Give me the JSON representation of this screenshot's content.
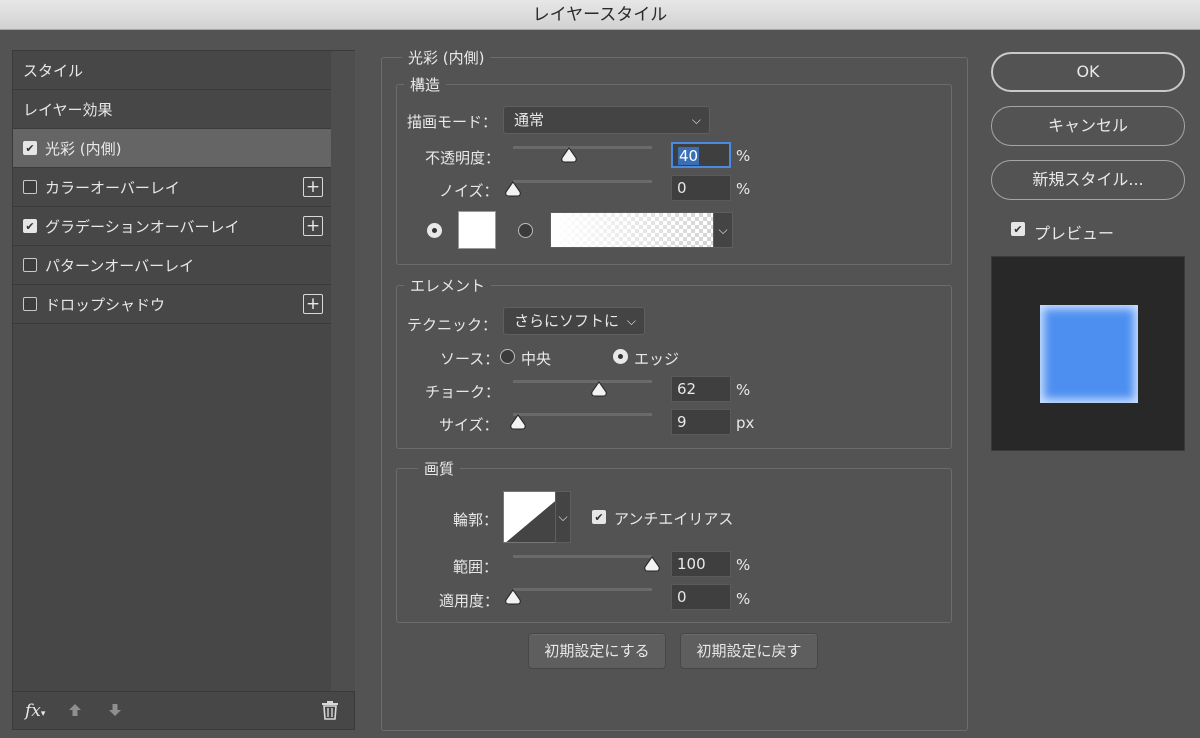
{
  "window": {
    "title": "レイヤースタイル"
  },
  "left_panel": {
    "items": [
      {
        "label": "スタイル",
        "checkbox": false,
        "checked": false,
        "plus": false,
        "selected": false
      },
      {
        "label": "レイヤー効果",
        "checkbox": false,
        "checked": false,
        "plus": false,
        "selected": false
      },
      {
        "label": "光彩 (内側)",
        "checkbox": true,
        "checked": true,
        "plus": false,
        "selected": true
      },
      {
        "label": "カラーオーバーレイ",
        "checkbox": true,
        "checked": false,
        "plus": true,
        "selected": false
      },
      {
        "label": "グラデーションオーバーレイ",
        "checkbox": true,
        "checked": true,
        "plus": true,
        "selected": false
      },
      {
        "label": "パターンオーバーレイ",
        "checkbox": true,
        "checked": false,
        "plus": false,
        "selected": false
      },
      {
        "label": "ドロップシャドウ",
        "checkbox": true,
        "checked": false,
        "plus": true,
        "selected": false
      }
    ],
    "footer": {
      "fx_label": "fx"
    }
  },
  "panel": {
    "title": "光彩 (内側)",
    "structure": {
      "title": "構造",
      "blend_mode_label": "描画モード：",
      "blend_mode_value": "通常",
      "opacity_label": "不透明度：",
      "opacity_value": "40",
      "opacity_level": 40,
      "opacity_unit": "%",
      "noise_label": "ノイズ：",
      "noise_value": "0",
      "noise_level": 0,
      "noise_unit": "%"
    },
    "elements": {
      "title": "エレメント",
      "technique_label": "テクニック：",
      "technique_value": "さらにソフトに",
      "source_label": "ソース：",
      "source_center": "中央",
      "source_edge": "エッジ",
      "choke_label": "チョーク：",
      "choke_value": "62",
      "choke_level": 62,
      "choke_unit": "%",
      "size_label": "サイズ：",
      "size_value": "9",
      "size_unit": "px"
    },
    "quality": {
      "title": "画質",
      "contour_label": "輪郭：",
      "antialias_label": "アンチエイリアス",
      "range_label": "範囲：",
      "range_value": "100",
      "range_level": 100,
      "range_unit": "%",
      "jitter_label": "適用度：",
      "jitter_value": "0",
      "jitter_level": 0,
      "jitter_unit": "%"
    },
    "buttons": {
      "make_default": "初期設定にする",
      "reset_default": "初期設定に戻す"
    }
  },
  "right": {
    "ok": "OK",
    "cancel": "キャンセル",
    "new_style": "新規スタイル...",
    "preview_label": "プレビュー",
    "preview_checked": true
  },
  "colors": {
    "preview_fill": "#4d8ff0",
    "focus_border": "#4a8ae3"
  }
}
